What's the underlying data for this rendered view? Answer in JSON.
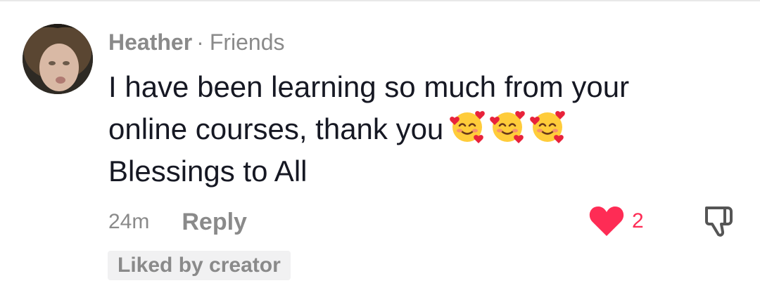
{
  "comment": {
    "author": "Heather",
    "separator": "·",
    "relation": "Friends",
    "text_lines": [
      "I have been learning so much from your",
      "online courses, thank you",
      "Blessings to All"
    ],
    "emojis": [
      "smiling-face-with-hearts",
      "smiling-face-with-hearts",
      "smiling-face-with-hearts"
    ],
    "timestamp": "24m",
    "reply_label": "Reply",
    "like_count": "2",
    "liked": true,
    "badge_label": "Liked by creator"
  },
  "colors": {
    "text_primary": "#161823",
    "text_secondary": "#8a8a8a",
    "like_red": "#fe2c55",
    "badge_bg": "#f1f1f2"
  }
}
